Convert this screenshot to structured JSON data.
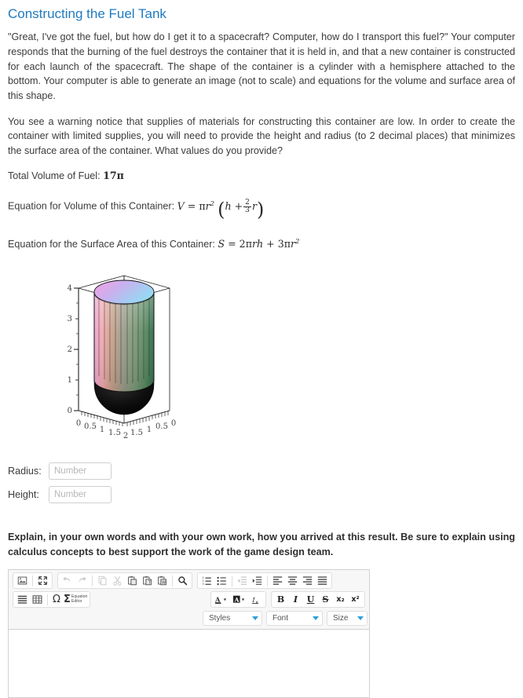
{
  "page": {
    "title": "Constructing the Fuel Tank",
    "paragraph1": "\"Great, I've got the fuel, but how do I get it to a spacecraft? Computer, how do I transport this fuel?\" Your computer responds that the burning of the fuel destroys the container that it is held in, and that a new container is constructed for each launch of the spacecraft. The shape of the container is a cylinder with a hemisphere attached to the bottom. Your computer is able to generate an image (not to scale) and equations for the volume and surface area of this shape.",
    "paragraph2": "You see a warning notice that supplies of materials for constructing this container are low. In order to create the container with limited supplies, you will need to provide the height and radius (to 2 decimal places) that minimizes the surface area of the container. What values do you provide?",
    "volume_label": "Total Volume of Fuel:",
    "volume_value": "17π",
    "volume_eq_label": "Equation for Volume of this Container:",
    "surface_eq_label": "Equation for the Surface Area of this Container:",
    "prompt": "Explain, in your own words and with your own work, how you arrived at this result. Be sure to explain using calculus concepts to best support the work of the game design team."
  },
  "equations": {
    "volume": {
      "lhs": "V",
      "eq": "=",
      "pi": "π",
      "r": "r",
      "r_exp": "2",
      "open_paren": "(",
      "h": "h",
      "plus": "+",
      "frac_num": "2",
      "frac_den": "3",
      "frac_var": "r",
      "close_paren": ")"
    },
    "surface": {
      "lhs": "S",
      "eq": "=",
      "coef1": "2",
      "pi1": "π",
      "r1": "r",
      "h": "h",
      "plus": "+",
      "coef2": "3",
      "pi2": "π",
      "r2": "r",
      "r2_exp": "2"
    }
  },
  "chart_data": {
    "type": "surface3d",
    "title": "",
    "description": "3D surface plot of a cylinder with a hemisphere attached to the bottom",
    "xlabel": "",
    "ylabel": "",
    "zlabel": "",
    "z_ticks": [
      "0",
      "1",
      "2",
      "3",
      "4"
    ],
    "zlim": [
      0,
      4
    ],
    "x_ticks_left": [
      "0",
      "0.5",
      "1",
      "1.5"
    ],
    "x_tick_center": "2",
    "x_ticks_right": [
      "1.5",
      "1",
      "0.5",
      "0"
    ],
    "xlim": [
      0,
      2
    ],
    "ylim": [
      0,
      2
    ],
    "grid": false,
    "legend": null,
    "geometry": {
      "cylinder_radius": 1,
      "cylinder_top_z": 4,
      "cylinder_bottom_z": 1,
      "hemisphere_center_z": 1,
      "hemisphere_radius": 1
    },
    "colors": {
      "cylinder_left": "#e8a0c8",
      "cylinder_mid": "#9a9a8e",
      "cylinder_right": "#3f7a4f",
      "cap_left": "#e9a6e0",
      "cap_right": "#8fd8ef",
      "hemisphere": "#0b0b0b",
      "wireframe": "#1a1a1a",
      "axis": "#2a2a2a",
      "tick_label": "#555555"
    }
  },
  "fields": {
    "radius": {
      "label": "Radius:",
      "value": "",
      "placeholder": "Number"
    },
    "height": {
      "label": "Height:",
      "value": "",
      "placeholder": "Number"
    }
  },
  "editor": {
    "toolbar_row1": [
      {
        "name": "image-button",
        "glyph": "image"
      },
      {
        "name": "maximize-button",
        "glyph": "maximize"
      },
      {
        "name": "undo-button",
        "glyph": "undo"
      },
      {
        "name": "redo-button",
        "glyph": "redo"
      },
      {
        "name": "copy-button",
        "glyph": "copy"
      },
      {
        "name": "cut-button",
        "glyph": "cut"
      },
      {
        "name": "paste-button",
        "glyph": "paste"
      },
      {
        "name": "paste-text-button",
        "glyph": "paste-text"
      },
      {
        "name": "paste-word-button",
        "glyph": "paste-word"
      },
      {
        "name": "find-button",
        "glyph": "search"
      },
      {
        "name": "numbered-list-button",
        "glyph": "numbered-list"
      },
      {
        "name": "bulleted-list-button",
        "glyph": "bulleted-list"
      },
      {
        "name": "decrease-indent-button",
        "glyph": "outdent"
      },
      {
        "name": "increase-indent-button",
        "glyph": "indent"
      },
      {
        "name": "align-left-button",
        "glyph": "align-left"
      },
      {
        "name": "align-center-button",
        "glyph": "align-center"
      },
      {
        "name": "align-right-button",
        "glyph": "align-right"
      },
      {
        "name": "align-justify-button",
        "glyph": "align-justify"
      }
    ],
    "toolbar_row2_left": [
      {
        "name": "blockquote-button",
        "glyph": "lines"
      },
      {
        "name": "table-button",
        "glyph": "table"
      },
      {
        "name": "special-character-button",
        "glyph": "Ω"
      },
      {
        "name": "equation-editor-button",
        "glyph": "Σ"
      }
    ],
    "equation_editor_label_line1": "Equation",
    "equation_editor_label_line2": "Editor",
    "toolbar_row2_right": [
      {
        "name": "text-color-button",
        "glyph": "A"
      },
      {
        "name": "background-color-button",
        "glyph": "A"
      },
      {
        "name": "remove-format-button",
        "glyph": "Ix"
      },
      {
        "name": "bold-button",
        "glyph": "B"
      },
      {
        "name": "italic-button",
        "glyph": "I"
      },
      {
        "name": "underline-button",
        "glyph": "U"
      },
      {
        "name": "strikethrough-button",
        "glyph": "S"
      },
      {
        "name": "subscript-button",
        "glyph": "x₂"
      },
      {
        "name": "superscript-button",
        "glyph": "x²"
      }
    ],
    "selects": {
      "styles": "Styles",
      "font": "Font",
      "size": "Size"
    },
    "body_value": ""
  }
}
